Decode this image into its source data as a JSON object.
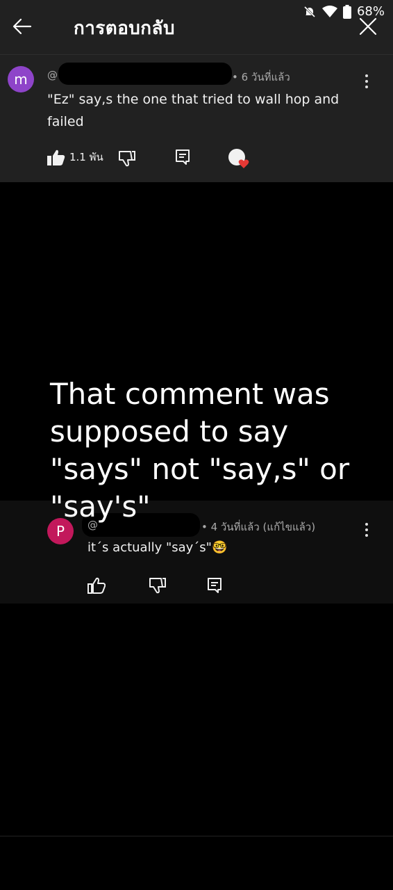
{
  "status_bar": {
    "battery": "68%"
  },
  "header": {
    "title": "การตอบกลับ"
  },
  "comments": [
    {
      "avatar_letter": "m",
      "handle": "@",
      "time": "• 6 วันที่แล้ว",
      "text_line1": "\"Ez\" say,s the one that tried to wall hop and",
      "text_line2": "failed",
      "like_count": "1.1 พัน"
    },
    {
      "avatar_letter": "P",
      "handle": "@",
      "time": "• 4 วันที่แล้ว (แก้ไขแล้ว)",
      "text": "it´s actually \"say´s\"🤓"
    }
  ],
  "overlay": {
    "line1": "That comment was",
    "line2": "supposed to say",
    "line3": "\"says\" not \"say,s\" or",
    "line4": "\"say's\""
  },
  "colors": {
    "surface": "#212121",
    "background": "#000000",
    "avatar_m": "#8e44c9",
    "avatar_p": "#c2185b",
    "heart": "#e53935"
  }
}
